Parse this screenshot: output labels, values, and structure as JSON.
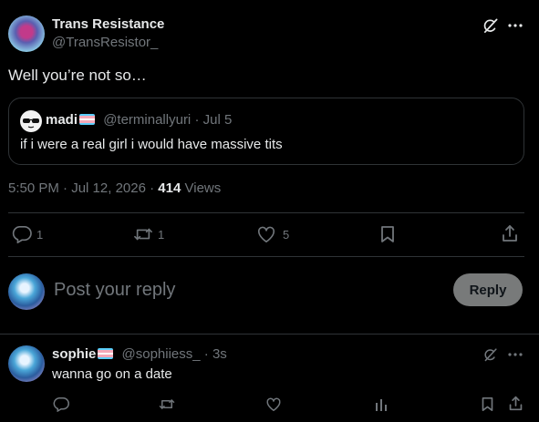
{
  "post": {
    "author_name": "Trans Resistance",
    "author_handle": "@TransResistor_",
    "text": "Well you’re not so…",
    "time": "5:50 PM",
    "date": "Jul 12, 2026",
    "views_count": "414",
    "views_label": "Views",
    "sep": "·"
  },
  "quote": {
    "author_name": "madi",
    "author_handle": "@terminallyuri",
    "date": "Jul 5",
    "text": "if i were a real girl i would have massive tits",
    "sep": "·"
  },
  "actions": {
    "replies": "1",
    "reposts": "1",
    "likes": "5"
  },
  "composer": {
    "placeholder": "Post your reply",
    "reply_button": "Reply"
  },
  "reply": {
    "author_name": "sophie",
    "author_handle": "@sophiiess_",
    "time": "3s",
    "text": "wanna go on a date",
    "sep": "·"
  },
  "colors": {
    "background": "#000000",
    "text": "#e7e9ea",
    "muted": "#71767b",
    "border": "#2f3336",
    "flag_blue": "#5bcefa",
    "flag_pink": "#f5a9b8",
    "flag_white": "#ffffff"
  }
}
